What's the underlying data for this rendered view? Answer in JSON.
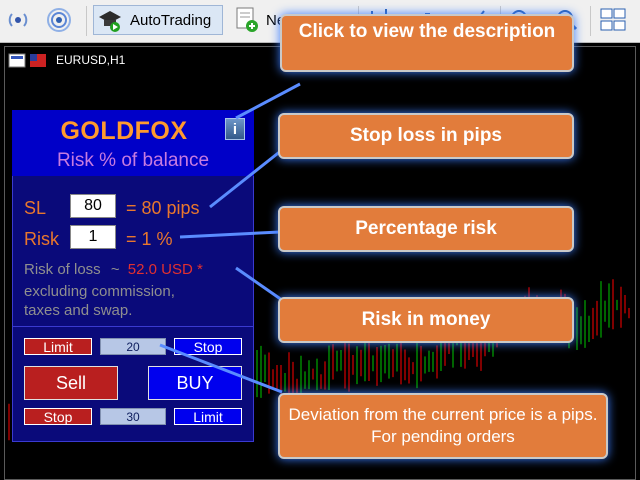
{
  "toolbar": {
    "autotrading_label": "AutoTrading",
    "new_order_label": "New Orde"
  },
  "chart": {
    "symbol": "EURUSD,H1"
  },
  "panel": {
    "title": "GOLDFOX",
    "info_label": "i",
    "subtitle": "Risk % of balance",
    "sl_label": "SL",
    "sl_value": "80",
    "sl_text": "= 80 pips",
    "risk_label": "Risk",
    "risk_value": "1",
    "risk_text": "= 1 %",
    "loss_label": "Risk of loss",
    "loss_tilde": "~",
    "loss_amount": "52.0 USD *",
    "note_line1": "excluding commission,",
    "note_line2": "taxes and swap.",
    "limit_top": "Limit",
    "deviation_top": "20",
    "stop_top": "Stop",
    "sell": "Sell",
    "buy": "BUY",
    "stop_bottom": "Stop",
    "deviation_bottom": "30",
    "limit_bottom": "Limit"
  },
  "callouts": {
    "description": "Click to view the description",
    "stoploss": "Stop loss in pips",
    "percent": "Percentage risk",
    "money": "Risk in money",
    "deviation": "Deviation from the current price is a pips. For pending orders"
  },
  "colors": {
    "accent_orange": "#e27c3b",
    "panel_blue": "#0000c8",
    "bull_candle": "#00c800",
    "bear_candle": "#ff0000"
  }
}
